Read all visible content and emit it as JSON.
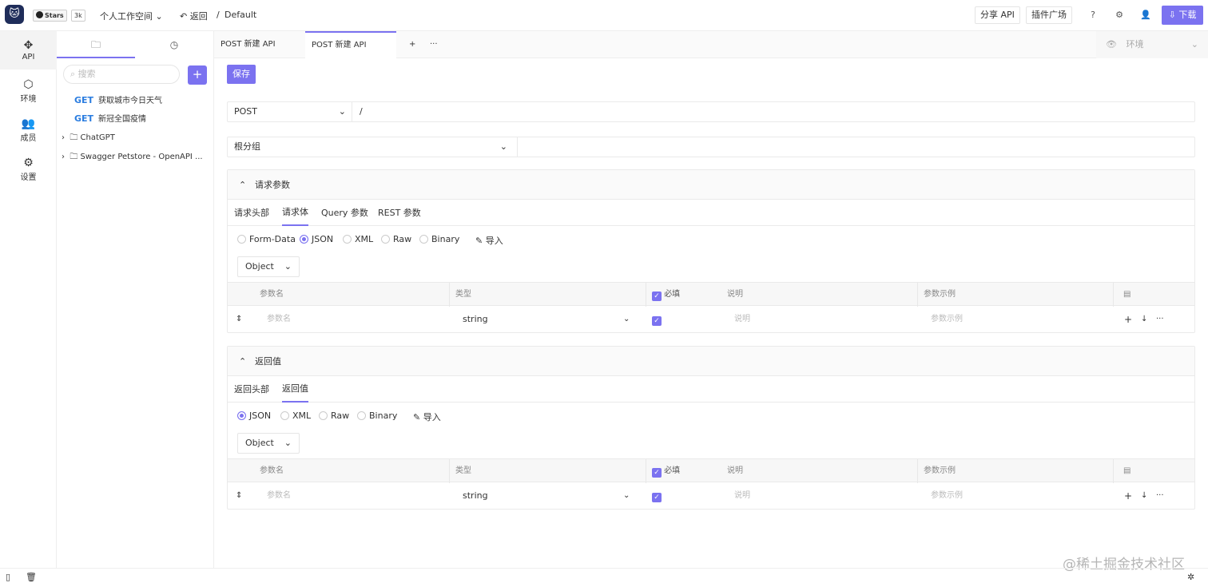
{
  "app": {
    "github_stars_label": "Stars",
    "github_stars_count": "3k",
    "workspace": "个人工作空间",
    "back_label": "返回",
    "breadcrumb_sep": "/",
    "project": "Default",
    "share_api": "分享 API",
    "plugin_market": "插件广场",
    "download": "下载",
    "accent_color": "#7b72f0"
  },
  "rail": [
    {
      "label": "API",
      "icon": "api-icon"
    },
    {
      "label": "环境",
      "icon": "environment-icon"
    },
    {
      "label": "成员",
      "icon": "members-icon"
    },
    {
      "label": "设置",
      "icon": "settings-icon"
    }
  ],
  "tree": {
    "search_placeholder": "搜索",
    "add": "+",
    "items": [
      {
        "method": "GET",
        "name": "获取城市今日天气"
      },
      {
        "method": "GET",
        "name": "新冠全国疫情"
      },
      {
        "method": "",
        "name": "ChatGPT"
      },
      {
        "method": "",
        "name": "Swagger Petstore - OpenAPI ..."
      }
    ]
  },
  "tabs": {
    "items": [
      "POST 新建 API",
      "POST 新建 API"
    ],
    "add": "+",
    "more": "···",
    "env_placeholder": "环境"
  },
  "editor": {
    "save": "保存",
    "method": "POST",
    "path": "/",
    "group": "根分组",
    "request": {
      "title": "请求参数",
      "tabs": [
        "请求头部",
        "请求体",
        "Query 参数",
        "REST 参数"
      ],
      "body_types": [
        "Form-Data",
        "JSON",
        "XML",
        "Raw",
        "Binary"
      ],
      "import": "导入",
      "root_type": "Object"
    },
    "response": {
      "title": "返回值",
      "tabs": [
        "返回头部",
        "返回值"
      ],
      "body_types": [
        "JSON",
        "XML",
        "Raw",
        "Binary"
      ],
      "import": "导入",
      "root_type": "Object"
    },
    "table": {
      "col_name": "参数名",
      "col_type": "类型",
      "col_required": "必填",
      "col_desc": "说明",
      "col_example": "参数示例",
      "row_name_placeholder": "参数名",
      "row_type": "string",
      "row_desc_placeholder": "说明",
      "row_example_placeholder": "参数示例"
    }
  },
  "watermark": "@稀土掘金技术社区"
}
